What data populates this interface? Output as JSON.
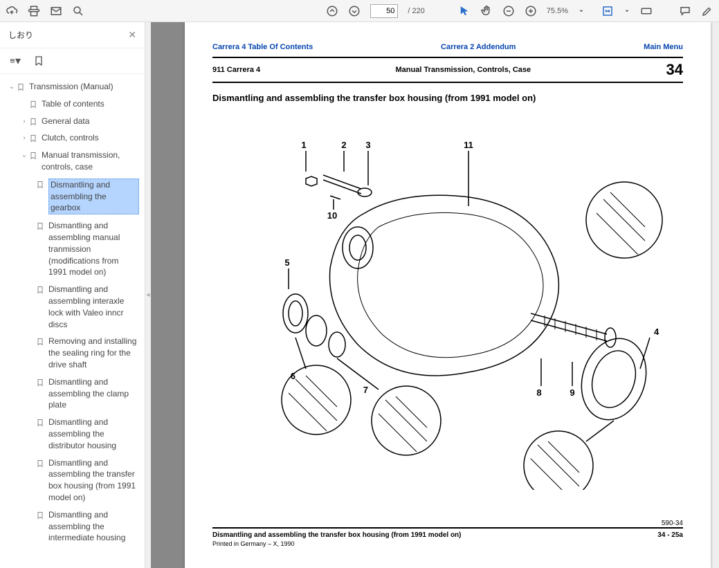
{
  "toolbar": {
    "page_current": "50",
    "page_total": "/ 220",
    "zoom": "75.5%"
  },
  "sidebar": {
    "title": "しおり",
    "tree": {
      "root_label": "Transmission (Manual)",
      "lvl1": {
        "toc": "Table of contents",
        "general": "General data",
        "clutch": "Clutch, controls",
        "manual": "Manual transmission, controls, case"
      },
      "leaves": {
        "a": "Dismantling and assembling the gearbox",
        "b": "Dismantling and assembling manual tranmission (modifications from 1991 model on)",
        "c": "Dismantling and assembling interaxle lock with Valeo inncr discs",
        "d": "Removing and installing the sealing ring for the drive shaft",
        "e": "Dismantling and assembling the clamp plate",
        "f": "Dismantling and assembling the distributor housing",
        "g": "Dismantling and assembling the transfer box housing (from 1991 model on)",
        "h": "Dismantling and assembling the intermediate housing"
      }
    }
  },
  "page": {
    "link_c4toc": "Carrera 4 Table Of Contents",
    "link_c2add": "Carrera 2 Addendum",
    "link_main": "Main Menu",
    "hdr_model": "911 Carrera 4",
    "hdr_section": "Manual Transmission, Controls, Case",
    "hdr_number": "34",
    "title": "Dismantling and assembling the transfer box housing (from 1991 model on)",
    "fig_num": "590-34",
    "footer_title": "Dismantling and assembling the transfer box housing (from 1991 model on)",
    "footer_page": "34 - 25a",
    "footer_print": "Printed in Germany – X, 1990",
    "callouts": {
      "1": "1",
      "2": "2",
      "3": "3",
      "4": "4",
      "5": "5",
      "6": "6",
      "7": "7",
      "8": "8",
      "9": "9",
      "10": "10",
      "11": "11"
    }
  }
}
